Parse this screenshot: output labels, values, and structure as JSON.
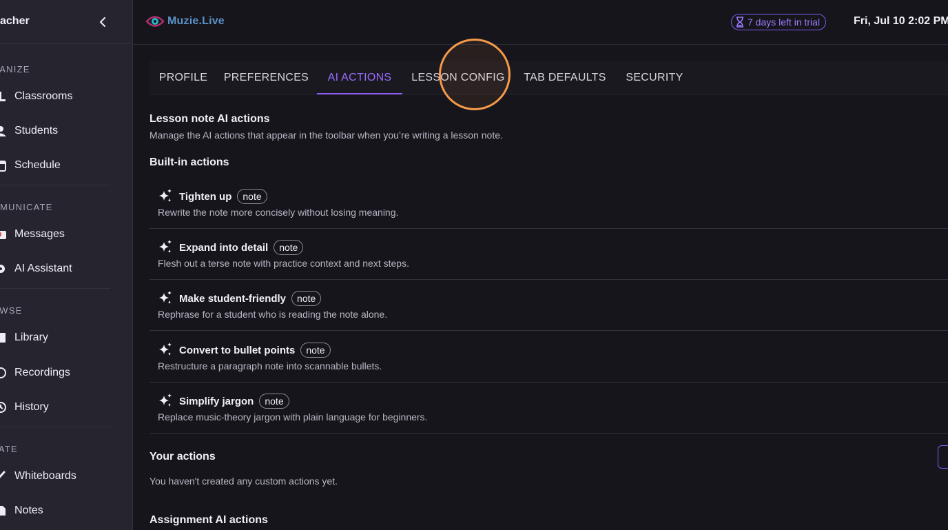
{
  "sidebar": {
    "title": "acher",
    "sections": [
      {
        "label": "GANIZE",
        "items": [
          {
            "label": "Classrooms",
            "icon": "classroom-icon"
          },
          {
            "label": "Students",
            "icon": "students-icon"
          },
          {
            "label": "Schedule",
            "icon": "calendar-icon"
          }
        ]
      },
      {
        "label": "MMUNICATE",
        "items": [
          {
            "label": "Messages",
            "icon": "messages-icon",
            "badge": true
          },
          {
            "label": "AI Assistant",
            "icon": "ai-assistant-icon"
          }
        ]
      },
      {
        "label": "OWSE",
        "items": [
          {
            "label": "Library",
            "icon": "library-icon"
          },
          {
            "label": "Recordings",
            "icon": "recordings-icon"
          },
          {
            "label": "History",
            "icon": "history-icon"
          }
        ]
      },
      {
        "label": "EATE",
        "items": [
          {
            "label": "Whiteboards",
            "icon": "whiteboard-icon"
          },
          {
            "label": "Notes",
            "icon": "notes-icon"
          }
        ]
      }
    ]
  },
  "topbar": {
    "logo_text": "Muzie.Live",
    "trial_text": "7 days left in trial",
    "datetime": "Fri, Jul 10 2:02 PM"
  },
  "tabs": [
    {
      "label": "PROFILE",
      "active": false
    },
    {
      "label": "PREFERENCES",
      "active": false
    },
    {
      "label": "AI ACTIONS",
      "active": true
    },
    {
      "label": "LESSON CONFIG",
      "active": false
    },
    {
      "label": "TAB DEFAULTS",
      "active": false
    },
    {
      "label": "SECURITY",
      "active": false
    }
  ],
  "content": {
    "lesson_heading": "Lesson note AI actions",
    "lesson_desc": "Manage the AI actions that appear in the toolbar when you’re writing a lesson note.",
    "builtin_heading": "Built-in actions",
    "actions": [
      {
        "name": "Tighten up",
        "tag": "note",
        "desc": "Rewrite the note more concisely without losing meaning."
      },
      {
        "name": "Expand into detail",
        "tag": "note",
        "desc": "Flesh out a terse note with practice context and next steps."
      },
      {
        "name": "Make student-friendly",
        "tag": "note",
        "desc": "Rephrase for a student who is reading the note alone."
      },
      {
        "name": "Convert to bullet points",
        "tag": "note",
        "desc": "Restructure a paragraph note into scannable bullets."
      },
      {
        "name": "Simplify jargon",
        "tag": "note",
        "desc": "Replace music-theory jargon with plain language for beginners."
      }
    ],
    "your_actions_heading": "Your actions",
    "your_actions_empty": "You haven't created any custom actions yet.",
    "assignment_heading": "Assignment AI actions"
  },
  "colors": {
    "accent": "#8b5cf6",
    "click_indicator": "#f59a4a",
    "sidebar_bg": "#26242f",
    "page_bg": "#17151c"
  }
}
